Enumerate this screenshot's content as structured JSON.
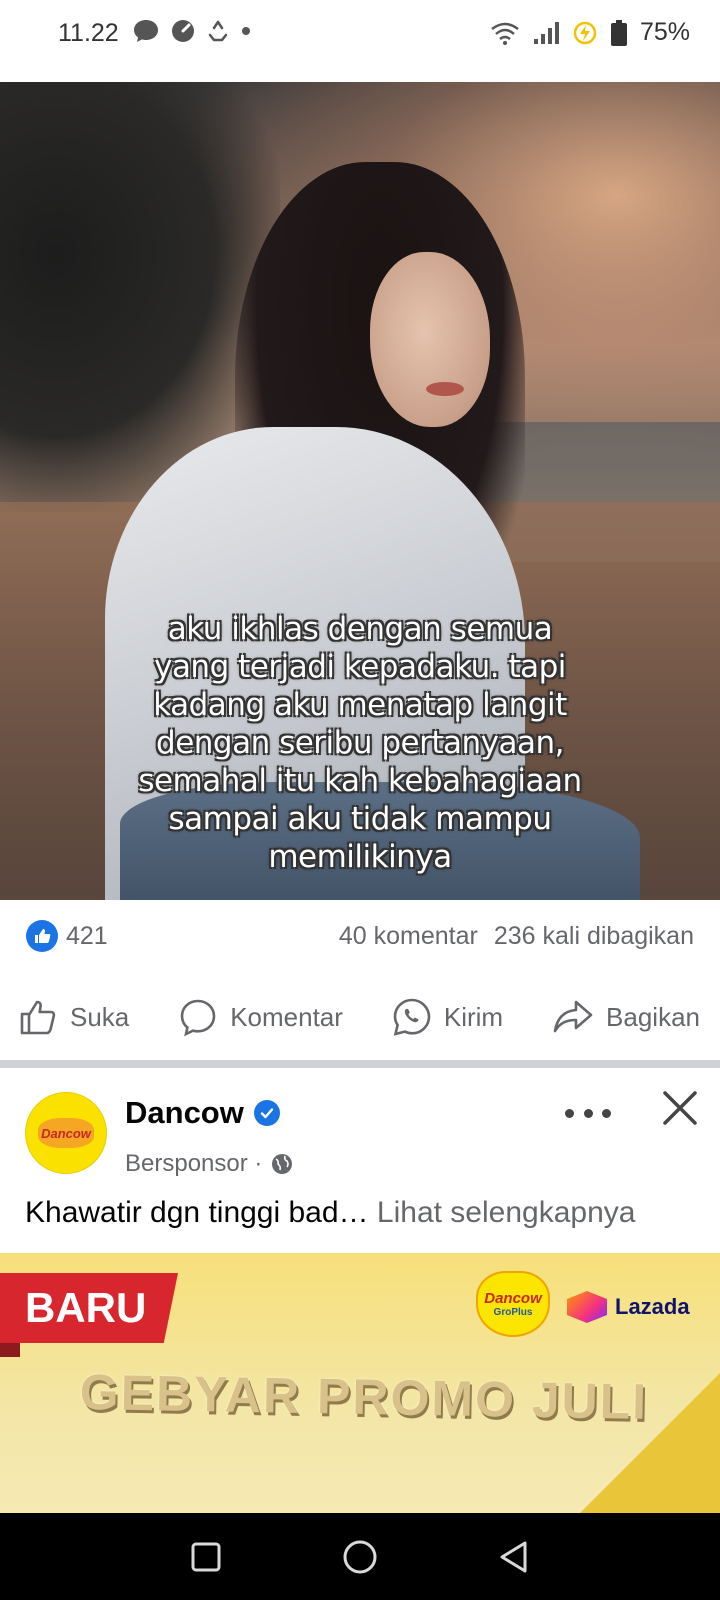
{
  "status_bar": {
    "time": "11.22",
    "battery": "75%",
    "left_icons": [
      "message-icon",
      "speedometer-icon",
      "recycle-icon",
      "dot-icon"
    ],
    "right_icons": [
      "wifi-icon",
      "signal-icon",
      "charging-icon",
      "battery-icon"
    ]
  },
  "post": {
    "quote_lines": [
      "aku ikhlas dengan semua",
      "yang terjadi kepadaku. tapi",
      "kadang aku menatap langit",
      "dengan seribu pertanyaan,",
      "semahal itu kah kebahagiaan",
      "sampai aku tidak mampu",
      "memilikinya"
    ],
    "likes": "421",
    "comments": "40 komentar",
    "shares": "236 kali dibagikan",
    "actions": {
      "like": "Suka",
      "comment": "Komentar",
      "send": "Kirim",
      "share": "Bagikan"
    }
  },
  "sponsored": {
    "name": "Dancow",
    "subtitle": "Bersponsor ·",
    "avatar_text": "Dancow",
    "text": "Khawatir dgn tinggi bad…",
    "see_more": "Lihat selengkapnya",
    "banner": {
      "ribbon": "BARU",
      "brand": "Dancow",
      "brand_sub": "GroPlus",
      "partner": "Lazada",
      "title": "GEBYAR PROMO JULI"
    }
  },
  "colors": {
    "facebook_blue": "#1b74e4",
    "secondary_text": "#65676b",
    "ribbon_red": "#d7262d",
    "banner_yellow": "#f7e07a"
  }
}
